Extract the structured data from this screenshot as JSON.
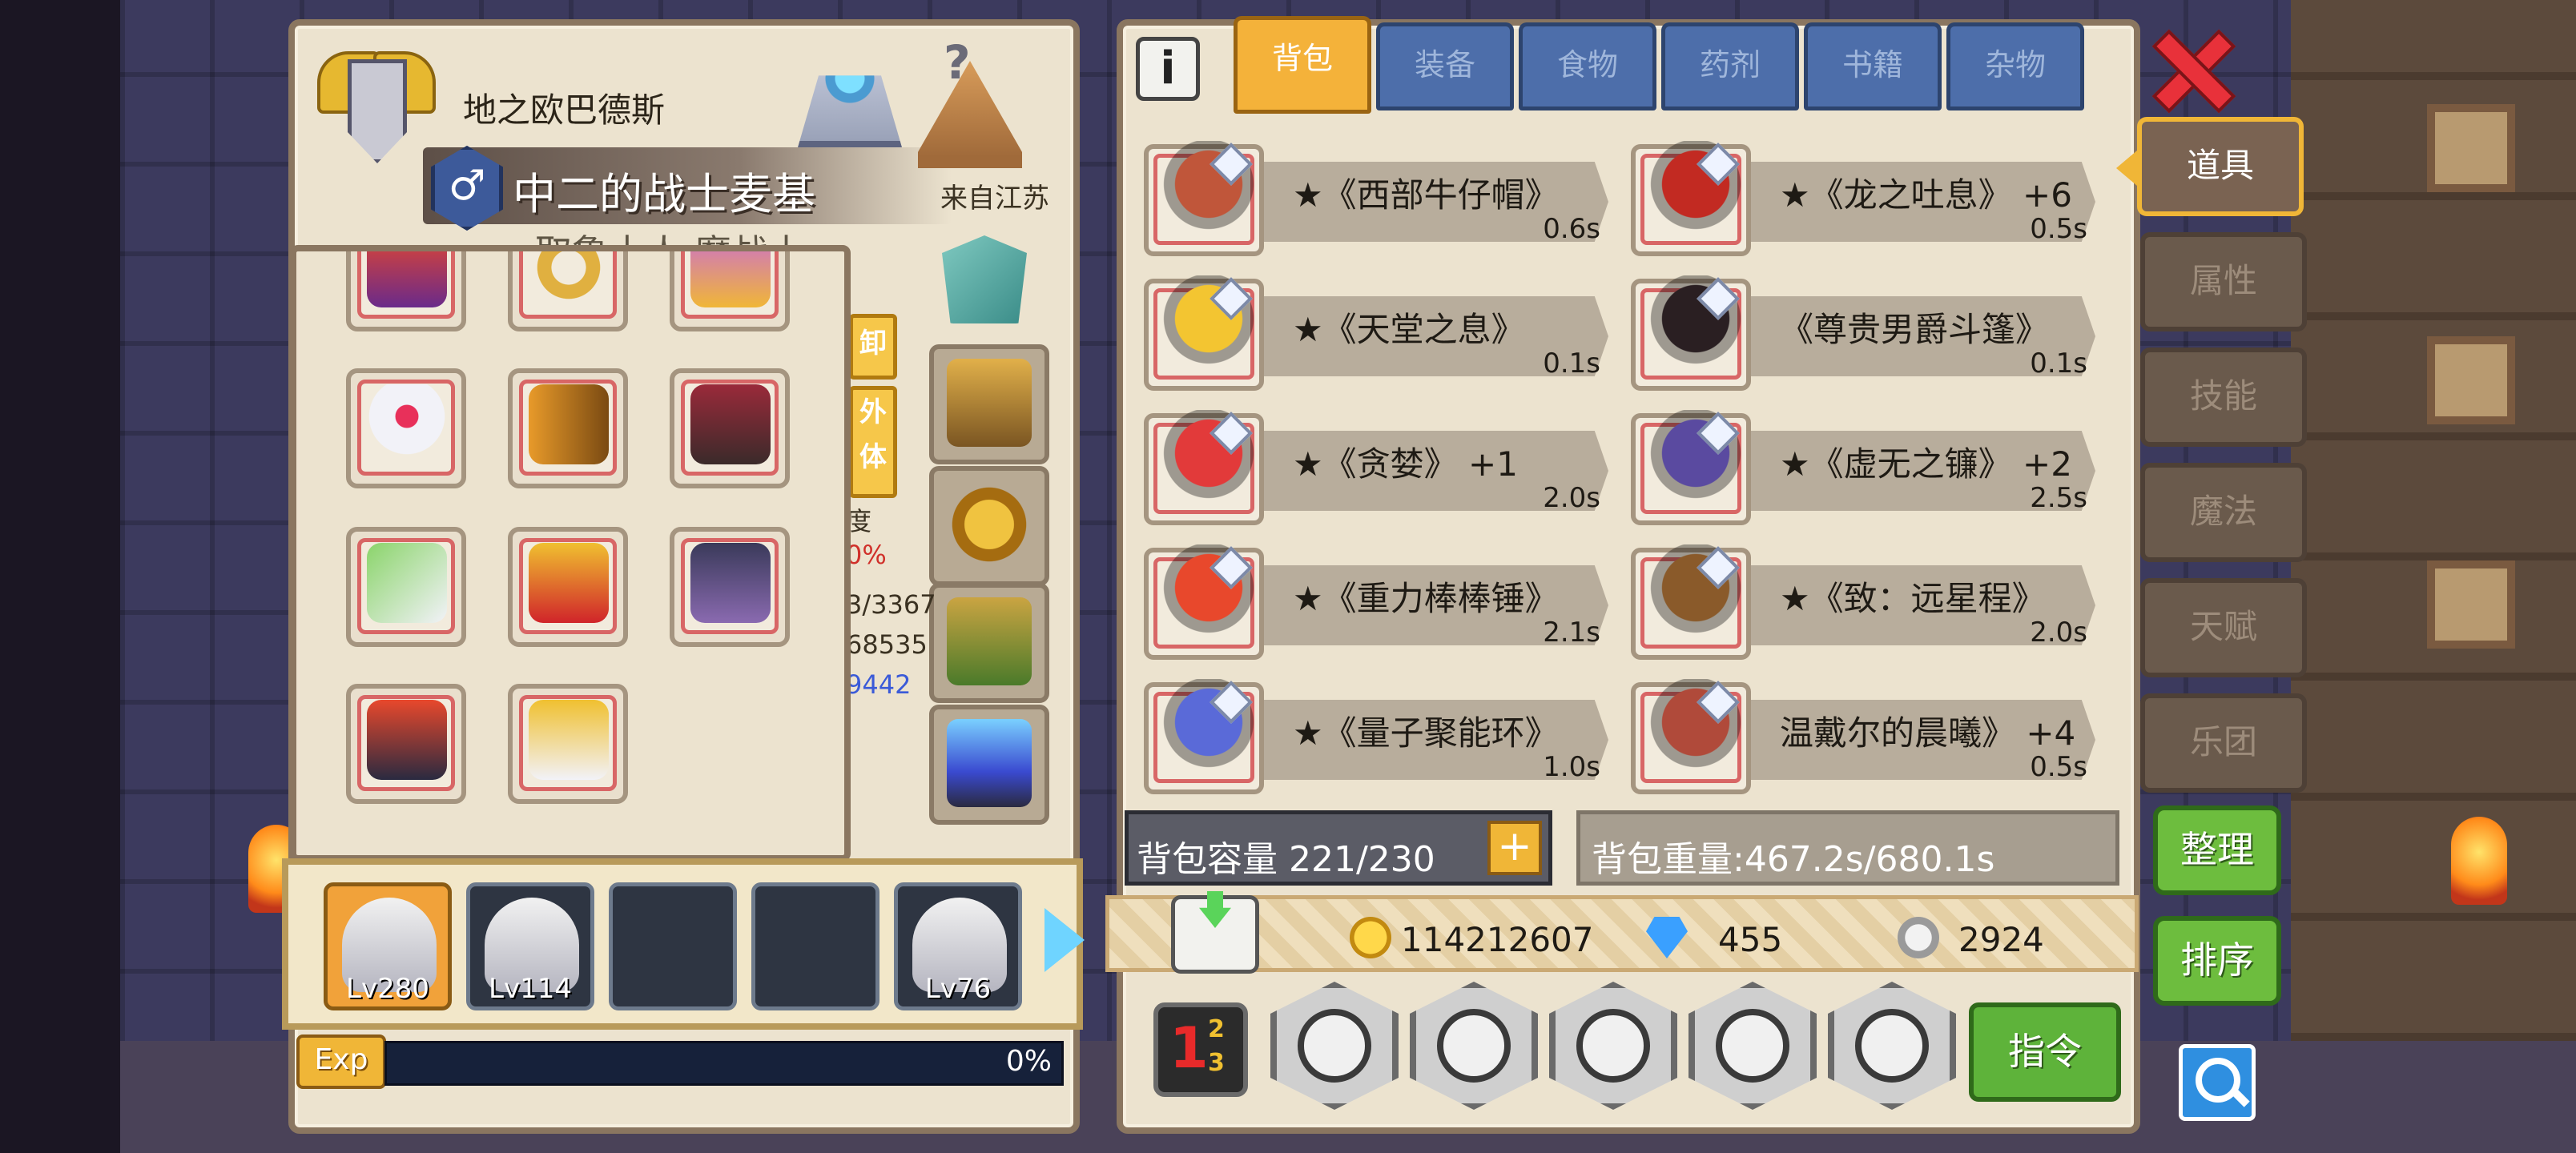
{
  "character": {
    "title": "地之欧巴德斯",
    "gender_symbol": "♂",
    "name": "中二的战士麦基",
    "origin": "来自江苏",
    "job_partial": "取鲁士人 魔战士",
    "side_tabs": [
      "卸",
      "外\n体"
    ],
    "stat_fragments": [
      "度",
      "0%",
      "3/3367",
      "68535",
      "9442"
    ]
  },
  "party": {
    "members": [
      {
        "level": "Lv280",
        "active": true
      },
      {
        "level": "Lv114",
        "active": false
      },
      {
        "level": "",
        "active": false
      },
      {
        "level": "",
        "active": false
      },
      {
        "level": "Lv76",
        "active": false
      }
    ]
  },
  "exp": {
    "label": "Exp",
    "percent_text": "0%",
    "progress": 0
  },
  "bag": {
    "info_icon": "info-icon",
    "tabs": [
      "背包",
      "装备",
      "食物",
      "药剂",
      "书籍",
      "杂物"
    ],
    "items": [
      {
        "name": "★《西部牛仔帽》",
        "time": "0.6s",
        "color": "#c0563a"
      },
      {
        "name": "★《龙之吐息》 +6",
        "time": "0.5s",
        "color": "#c22a22"
      },
      {
        "name": "★《天堂之息》",
        "time": "0.1s",
        "color": "#f3c531"
      },
      {
        "name": "《尊贵男爵斗篷》",
        "time": "0.1s",
        "color": "#2a1f22"
      },
      {
        "name": "★《贪婪》 +1",
        "time": "2.0s",
        "color": "#e23a3a"
      },
      {
        "name": "★《虚无之镰》 +2",
        "time": "2.5s",
        "color": "#5a4aa0"
      },
      {
        "name": "★《重力棒棒锤》",
        "time": "2.1s",
        "color": "#e8482c"
      },
      {
        "name": "★《致：远星程》",
        "time": "2.0s",
        "color": "#8a5a2a"
      },
      {
        "name": "★《量子聚能环》",
        "time": "1.0s",
        "color": "#5a6ad8"
      },
      {
        "name": "温戴尔的晨曦》 +4",
        "time": "0.5s",
        "color": "#b04a3a"
      }
    ],
    "capacity_text": "背包容量 221/230",
    "weight_text": "背包重量:467.2s/680.1s"
  },
  "currency": {
    "gold": "114212607",
    "diamond": "455",
    "silver": "2924"
  },
  "bottom_buttons": {
    "command": "指令",
    "hex_icons": [
      "book-icon",
      "magnify-icon",
      "search-item-icon",
      "swap-icon",
      "compass-icon"
    ]
  },
  "side_menu": {
    "tabs": [
      "道具",
      "属性",
      "技能",
      "魔法",
      "天赋",
      "乐团"
    ],
    "sort_buttons": [
      "整理",
      "排序"
    ]
  },
  "colors": {
    "accent_gold": "#f0b637",
    "tab_blue": "#4d6eaa",
    "panel": "#ece3cf",
    "green_button": "#6dbd3e"
  }
}
